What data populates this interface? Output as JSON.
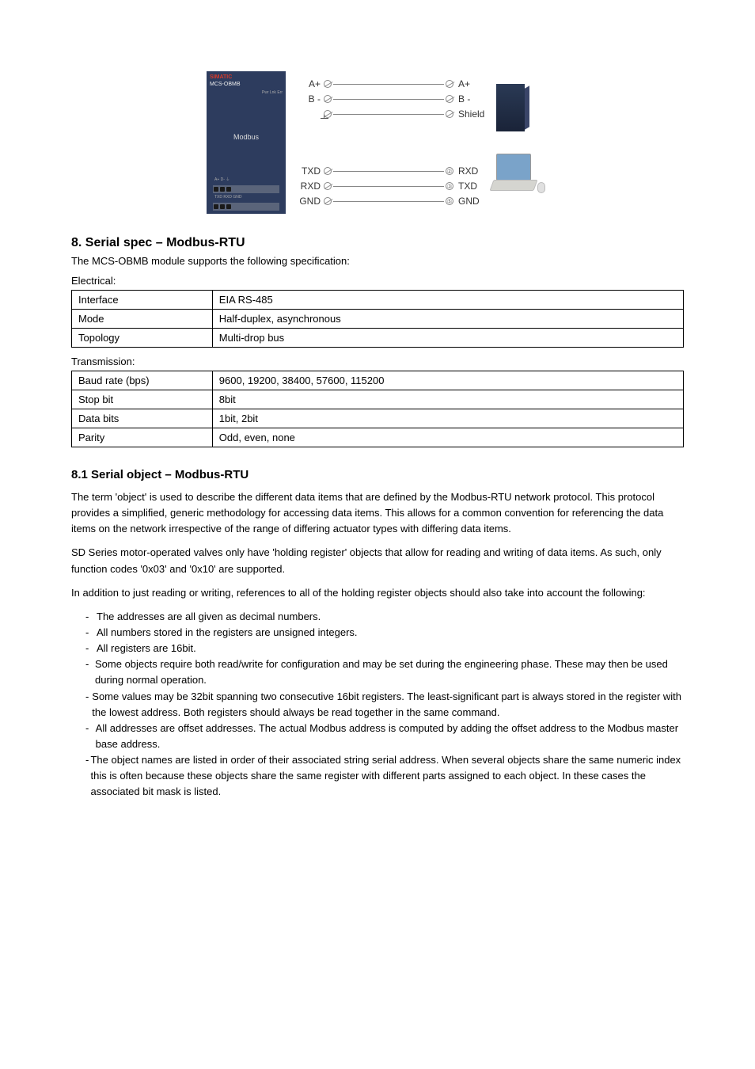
{
  "figure": {
    "module": {
      "brand": "SIMATIC",
      "model": "MCS-OBMB",
      "tiny": "Pwr  Lnk  Err",
      "mid": "Modbus",
      "labelrow": "A+ D-  ⏚"
    },
    "wiring": {
      "top": [
        {
          "left": "A+",
          "leftType": "oslash",
          "rightType": "oslash",
          "right": "A+"
        },
        {
          "left": "B -",
          "leftType": "oslash",
          "rightType": "oslash",
          "right": "B -"
        },
        {
          "left": "gnd",
          "leftType": "oslash",
          "rightType": "oslash",
          "right": "Shield"
        }
      ],
      "bottom": [
        {
          "left": "TXD",
          "leftType": "oslash",
          "rightNum": "②",
          "right": "RXD"
        },
        {
          "left": "RXD",
          "leftType": "oslash",
          "rightNum": "③",
          "right": "TXD"
        },
        {
          "left": "GND",
          "leftType": "oslash",
          "rightNum": "⑤",
          "right": "GND"
        }
      ]
    }
  },
  "section": {
    "title": "8. Serial spec – Modbus-RTU",
    "lead": "The MCS-OBMB module supports the following specification:",
    "electrical": {
      "heading": "Electrical:",
      "rows": [
        [
          "Interface",
          "EIA RS-485"
        ],
        [
          "Mode",
          "Half-duplex, asynchronous"
        ],
        [
          "Topology",
          "Multi-drop bus"
        ]
      ]
    },
    "transmission": {
      "heading": "Transmission:",
      "rows": [
        [
          "Baud rate (bps)",
          "9600, 19200, 38400, 57600, 115200"
        ],
        [
          "Stop bit",
          "8bit"
        ],
        [
          "Data bits",
          "1bit, 2bit"
        ],
        [
          "Parity",
          "Odd, even, none"
        ]
      ]
    }
  },
  "subsection": {
    "title": "8.1 Serial object – Modbus-RTU",
    "para1": "The term 'object' is used to describe the different data items that are defined by the Modbus-RTU network protocol. This protocol provides a simplified, generic methodology for accessing data items. This allows for a common convention for referencing the data items on the network irrespective of the range of differing actuator types with differing data items.",
    "para2": "SD Series motor-operated valves only have 'holding register' objects that allow for reading and writing of data items. As such, only function codes '0x03' and '0x10' are supported.",
    "para3": "In addition to just reading or writing, references to all of the holding register objects should also take into account the following:",
    "notices": [
      "The addresses are all given as decimal numbers.",
      "All numbers stored in the registers are unsigned integers.",
      "All registers are 16bit.",
      "Some objects require both read/write for configuration and may be set during the engineering phase. These may then be used during normal operation.",
      "Some values may be 32bit spanning two consecutive 16bit registers. The least-significant part is always stored in the register with the lowest address. Both registers should always be read together in the same command.",
      "All addresses are offset addresses. The actual Modbus address is computed by adding the offset address to the Modbus master base address.",
      "The object names are listed in order of their associated string serial address. When several objects share the same numeric index this is often because these objects share the same register with different parts assigned to each object. In these cases the associated bit mask is listed."
    ]
  }
}
